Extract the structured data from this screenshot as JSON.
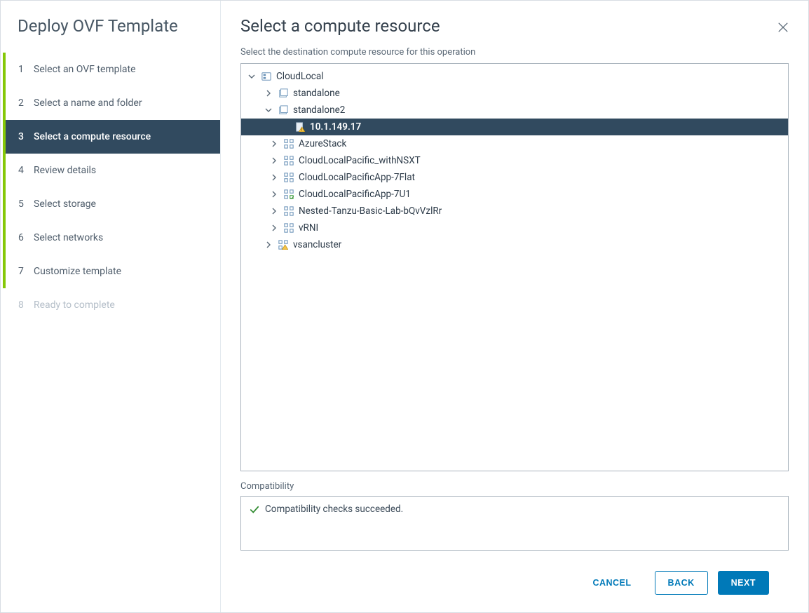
{
  "dialog_title": "Deploy OVF Template",
  "steps": [
    {
      "num": "1",
      "label": "Select an OVF template",
      "state": "complete"
    },
    {
      "num": "2",
      "label": "Select a name and folder",
      "state": "complete"
    },
    {
      "num": "3",
      "label": "Select a compute resource",
      "state": "active"
    },
    {
      "num": "4",
      "label": "Review details",
      "state": "complete"
    },
    {
      "num": "5",
      "label": "Select storage",
      "state": "complete"
    },
    {
      "num": "6",
      "label": "Select networks",
      "state": "complete"
    },
    {
      "num": "7",
      "label": "Customize template",
      "state": "complete"
    },
    {
      "num": "8",
      "label": "Ready to complete",
      "state": "inactive"
    }
  ],
  "page": {
    "title": "Select a compute resource",
    "subtitle": "Select the destination compute resource for this operation"
  },
  "tree": {
    "root": {
      "label": "CloudLocal",
      "icon": "datacenter",
      "expanded": true
    },
    "standalone": {
      "label": "standalone",
      "icon": "folder",
      "expanded": false
    },
    "standalone2": {
      "label": "standalone2",
      "icon": "folder",
      "expanded": true
    },
    "selected_host": {
      "label": "10.1.149.17",
      "icon": "host-warn",
      "expanded": null,
      "selected": true
    },
    "azure": {
      "label": "AzureStack",
      "icon": "cluster",
      "expanded": false
    },
    "pacific_nsxt": {
      "label": "CloudLocalPacific_withNSXT",
      "icon": "cluster",
      "expanded": false
    },
    "pacific_7flat": {
      "label": "CloudLocalPacificApp-7Flat",
      "icon": "cluster",
      "expanded": false
    },
    "pacific_7u1": {
      "label": "CloudLocalPacificApp-7U1",
      "icon": "cluster-green",
      "expanded": false
    },
    "tanzu": {
      "label": "Nested-Tanzu-Basic-Lab-bQvVzlRr",
      "icon": "cluster",
      "expanded": false
    },
    "vrni": {
      "label": "vRNI",
      "icon": "cluster",
      "expanded": false
    },
    "vsan": {
      "label": "vsancluster",
      "icon": "cluster-warn",
      "expanded": false
    }
  },
  "compat": {
    "label": "Compatibility",
    "msg": "Compatibility checks succeeded."
  },
  "buttons": {
    "cancel": "CANCEL",
    "back": "BACK",
    "next": "NEXT"
  }
}
